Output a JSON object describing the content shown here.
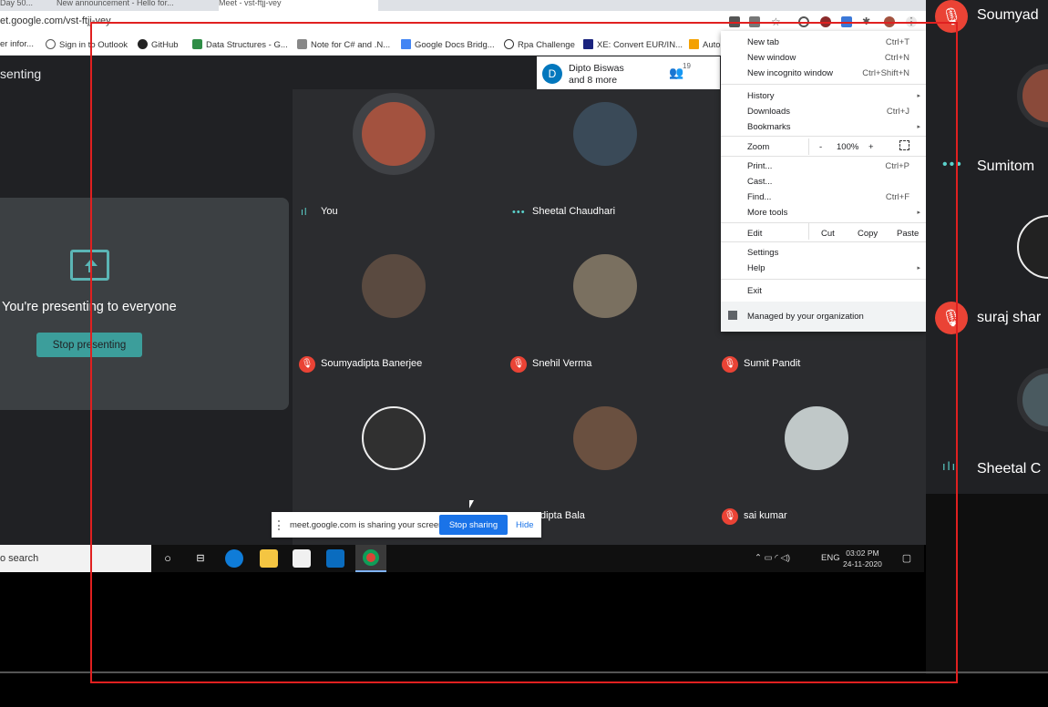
{
  "browser": {
    "tabs": [
      {
        "label": "Day 50..."
      },
      {
        "label": "New announcement - Hello for..."
      },
      {
        "label": "Meet - vst-ftjj-vey"
      }
    ],
    "url": "et.google.com/vst-ftjj-vey",
    "bookmarks": [
      {
        "label": "er infor...",
        "icon": "doc-icon"
      },
      {
        "label": "Sign in to Outlook",
        "icon": "globe-icon"
      },
      {
        "label": "GitHub",
        "icon": "github-icon"
      },
      {
        "label": "Data Structures - G...",
        "icon": "gfg-icon"
      },
      {
        "label": "Note for C# and .N...",
        "icon": "note-icon"
      },
      {
        "label": "Google Docs Bridg...",
        "icon": "docs-icon"
      },
      {
        "label": "Rpa Challenge",
        "icon": "robot-icon"
      },
      {
        "label": "XE: Convert EUR/IN...",
        "icon": "xe-icon"
      },
      {
        "label": "Auto",
        "icon": "auto-icon"
      }
    ]
  },
  "meet": {
    "presenting_label": "senting",
    "present_card_text": "You're presenting to everyone",
    "stop_presenting_label": "Stop presenting",
    "presenter_avatar_letter": "D",
    "presenter_name": "Dipto Biswas",
    "presenter_more": "and 8 more",
    "people_count": "19",
    "participants": [
      {
        "name": "You",
        "state": "speaking",
        "avatar_color": "#a3523f"
      },
      {
        "name": "Sheetal Chaudhari",
        "state": "speaking",
        "avatar_color": "#3a4a58"
      },
      {
        "name": "Soumyadipta Banerjee",
        "state": "muted",
        "avatar_color": "#5a4a40"
      },
      {
        "name": "Snehil Verma",
        "state": "muted",
        "avatar_color": "#7a7060"
      },
      {
        "name": "Sumit Pandit",
        "state": "muted",
        "avatar_color": "#8aa0b0"
      },
      {
        "name": "",
        "state": "muted",
        "avatar_color": "#303030"
      },
      {
        "name": "dipta Bala",
        "state": "muted",
        "avatar_color": "#6a5040"
      },
      {
        "name": "sai kumar",
        "state": "muted",
        "avatar_color": "#c0c8c8"
      }
    ]
  },
  "menu": {
    "items": [
      {
        "label": "New tab",
        "shortcut": "Ctrl+T"
      },
      {
        "label": "New window",
        "shortcut": "Ctrl+N"
      },
      {
        "label": "New incognito window",
        "shortcut": "Ctrl+Shift+N"
      },
      {
        "label": "History",
        "shortcut": "▸"
      },
      {
        "label": "Downloads",
        "shortcut": "Ctrl+J"
      },
      {
        "label": "Bookmarks",
        "shortcut": "▸"
      },
      {
        "label": "Print...",
        "shortcut": "Ctrl+P"
      },
      {
        "label": "Cast...",
        "shortcut": ""
      },
      {
        "label": "Find...",
        "shortcut": "Ctrl+F"
      },
      {
        "label": "More tools",
        "shortcut": "▸"
      },
      {
        "label": "Settings",
        "shortcut": ""
      },
      {
        "label": "Help",
        "shortcut": "▸"
      },
      {
        "label": "Exit",
        "shortcut": ""
      }
    ],
    "zoom_label": "Zoom",
    "zoom_minus": "-",
    "zoom_value": "100%",
    "zoom_plus": "+",
    "edit_label": "Edit",
    "cut_label": "Cut",
    "copy_label": "Copy",
    "paste_label": "Paste",
    "managed_label": "Managed by your organization"
  },
  "sharebar": {
    "text": "meet.google.com is sharing your screen.",
    "stop_label": "Stop sharing",
    "hide_label": "Hide"
  },
  "taskbar": {
    "search_text": "o search",
    "lang": "ENG",
    "time": "03:02 PM",
    "date": "24-11-2020"
  },
  "sidebar": {
    "people": [
      {
        "name": "Soumyad",
        "state": "muted"
      },
      {
        "name": "Sumitom",
        "state": "speaking"
      },
      {
        "name": "suraj shar",
        "state": "muted"
      },
      {
        "name": "Sheetal C",
        "state": "speaking"
      }
    ]
  },
  "colors": {
    "meet_bg": "#202124",
    "accent_teal": "#3c9e9b",
    "mute_red": "#ea4335",
    "share_blue": "#1a73e8",
    "frame_red": "#e02020"
  }
}
